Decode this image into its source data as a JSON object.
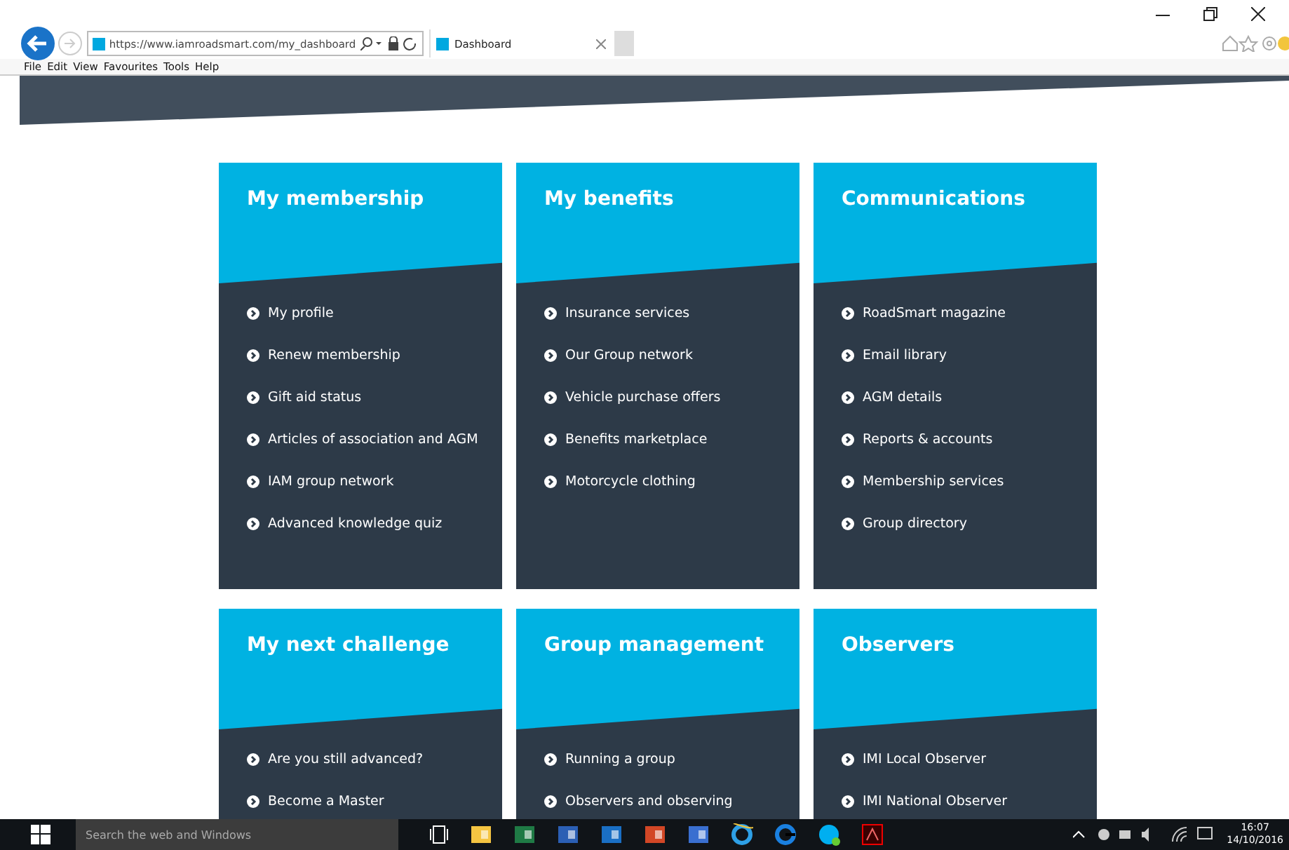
{
  "browser": {
    "url": "https://www.iamroadsmart.com/my_dashboard",
    "tab": "Dashboard",
    "menu": [
      "File",
      "Edit",
      "View",
      "Favourites",
      "Tools",
      "Help"
    ]
  },
  "cards": [
    {
      "title": "My membership",
      "items": [
        "My profile",
        "Renew membership",
        "Gift aid status",
        "Articles of association and AGM",
        "IAM group network",
        "Advanced knowledge quiz"
      ]
    },
    {
      "title": "My benefits",
      "items": [
        "Insurance services",
        "Our Group network",
        "Vehicle purchase offers",
        "Benefits marketplace",
        "Motorcycle clothing"
      ]
    },
    {
      "title": "Communications",
      "items": [
        "RoadSmart magazine",
        "Email library",
        "AGM details",
        "Reports & accounts",
        "Membership services",
        "Group directory"
      ]
    },
    {
      "title": "My next challenge",
      "items": [
        "Are you still advanced?",
        "Become a Master"
      ]
    },
    {
      "title": "Group management",
      "items": [
        "Running a group",
        "Observers and observing"
      ]
    },
    {
      "title": "Observers",
      "items": [
        "IMI Local Observer",
        "IMI National Observer"
      ]
    }
  ],
  "taskbar": {
    "search": "Search the web and Windows",
    "time": "16:07",
    "date": "14/10/2016"
  }
}
